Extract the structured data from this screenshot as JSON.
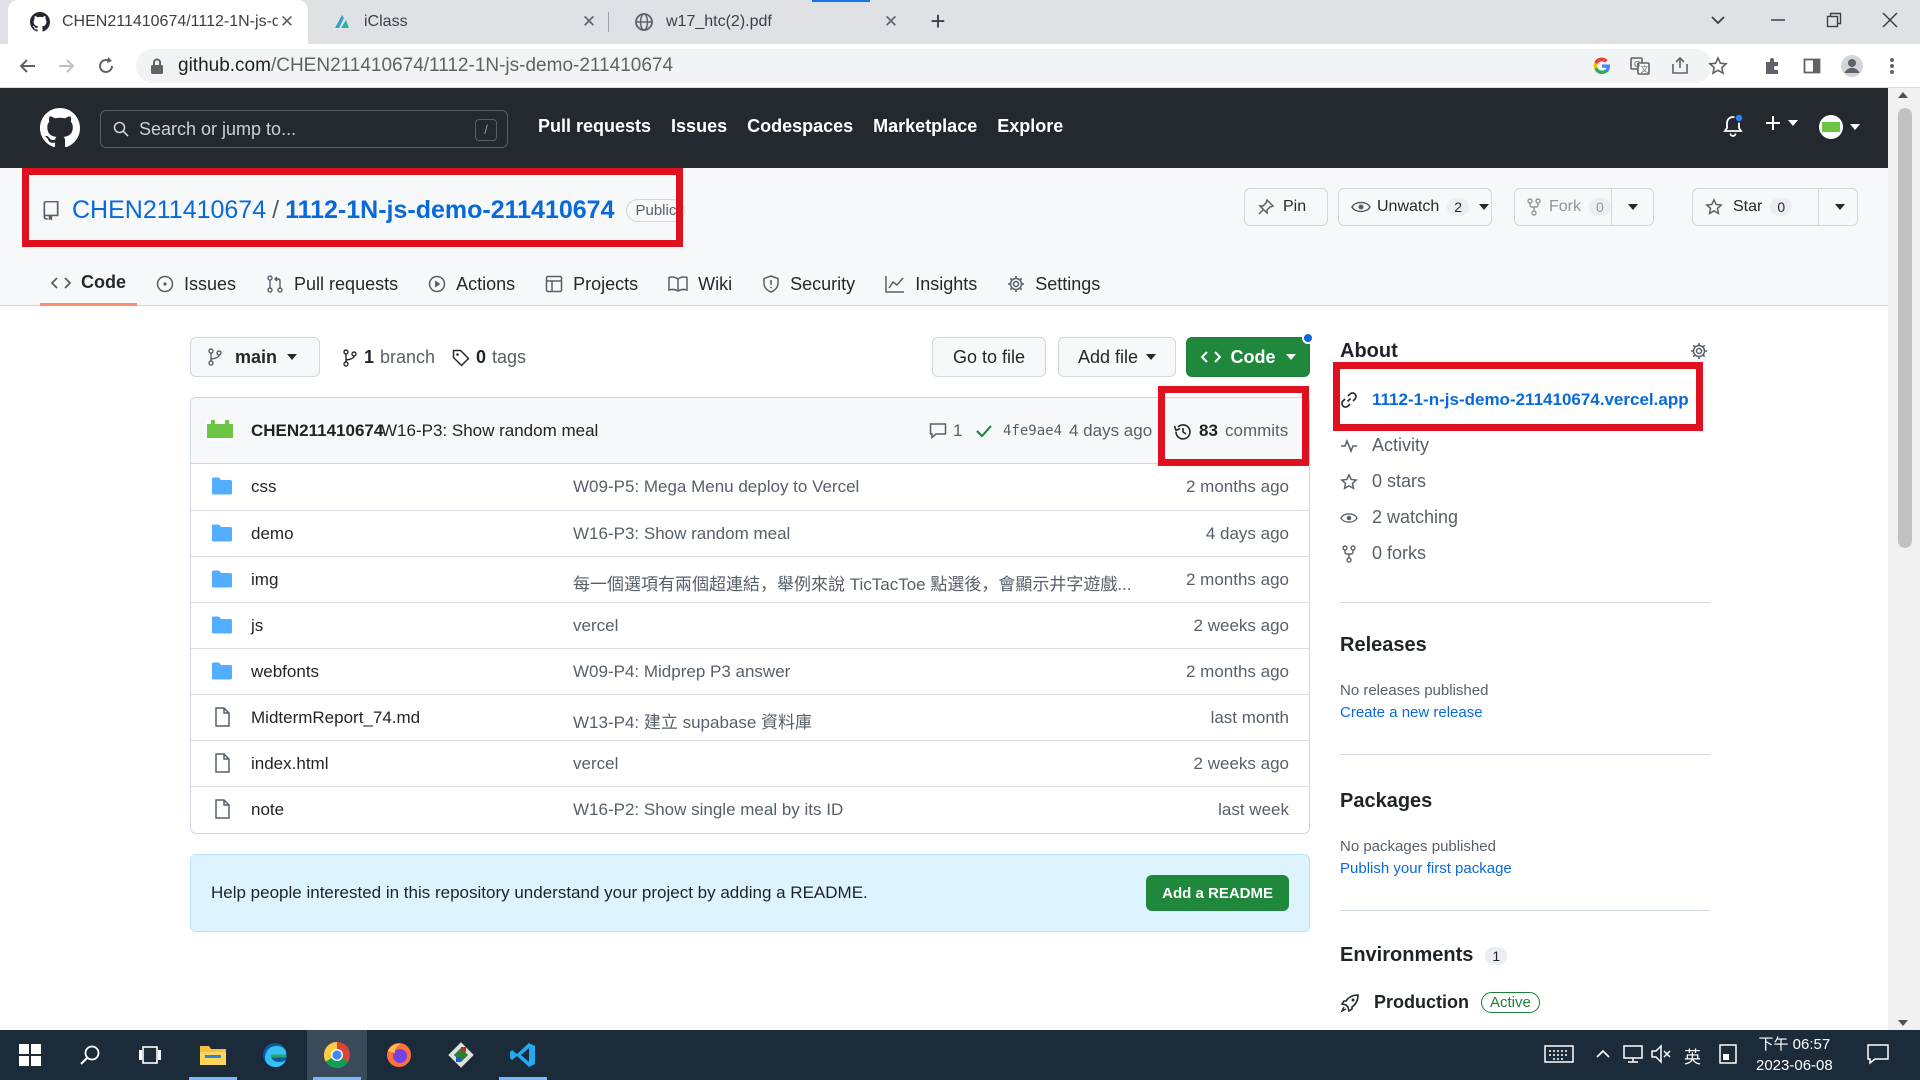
{
  "browser": {
    "tabs": [
      {
        "title": "CHEN211410674/1112-1N-js-d",
        "active": true
      },
      {
        "title": "iClass",
        "active": false
      },
      {
        "title": "w17_htc(2).pdf",
        "active": false
      }
    ],
    "url_host": "github.com",
    "url_path": "/CHEN211410674/1112-1N-js-demo-211410674"
  },
  "gh_header": {
    "search_placeholder": "Search or jump to...",
    "search_key": "/",
    "nav": [
      "Pull requests",
      "Issues",
      "Codespaces",
      "Marketplace",
      "Explore"
    ]
  },
  "repo": {
    "owner": "CHEN211410674",
    "separator": "/",
    "name": "1112-1N-js-demo-211410674",
    "visibility": "Public",
    "pin_label": "Pin",
    "watch_label": "Unwatch",
    "watch_count": "2",
    "fork_label": "Fork",
    "fork_count": "0",
    "star_label": "Star",
    "star_count": "0",
    "tabs": [
      "Code",
      "Issues",
      "Pull requests",
      "Actions",
      "Projects",
      "Wiki",
      "Security",
      "Insights",
      "Settings"
    ]
  },
  "toolbar": {
    "branch": "main",
    "branch_count": "1",
    "branch_word": "branch",
    "tag_count": "0",
    "tag_word": "tags",
    "goto_file": "Go to file",
    "add_file": "Add file",
    "code": "Code"
  },
  "latest_commit": {
    "author": "CHEN211410674",
    "message": "W16-P3: Show random meal",
    "comments": "1",
    "sha": "4fe9ae4",
    "age": "4 days ago",
    "commit_count": "83",
    "commit_word": "commits"
  },
  "files": [
    {
      "type": "dir",
      "name": "css",
      "message": "W09-P5: Mega Menu deploy to Vercel",
      "age": "2 months ago"
    },
    {
      "type": "dir",
      "name": "demo",
      "message": "W16-P3: Show random meal",
      "age": "4 days ago"
    },
    {
      "type": "dir",
      "name": "img",
      "message": "每一個選項有兩個超連結，舉例來說 TicTacToe 點選後，會顯示井字遊戲...",
      "age": "2 months ago"
    },
    {
      "type": "dir",
      "name": "js",
      "message": "vercel",
      "age": "2 weeks ago"
    },
    {
      "type": "dir",
      "name": "webfonts",
      "message": "W09-P4: Midprep P3 answer",
      "age": "2 months ago"
    },
    {
      "type": "file",
      "name": "MidtermReport_74.md",
      "message": "W13-P4: 建立 supabase 資料庫",
      "age": "last month"
    },
    {
      "type": "file",
      "name": "index.html",
      "message": "vercel",
      "age": "2 weeks ago"
    },
    {
      "type": "file",
      "name": "note",
      "message": "W16-P2: Show single meal by its ID",
      "age": "last week"
    }
  ],
  "readme_prompt": {
    "text": "Help people interested in this repository understand your project by adding a README.",
    "button": "Add a README"
  },
  "about": {
    "heading": "About",
    "link": "1112-1-n-js-demo-211410674.vercel.app",
    "activity": "Activity",
    "stars": "0 stars",
    "watching": "2 watching",
    "forks": "0 forks"
  },
  "releases": {
    "heading": "Releases",
    "none": "No releases published",
    "link": "Create a new release"
  },
  "packages": {
    "heading": "Packages",
    "none": "No packages published",
    "link": "Publish your first package"
  },
  "environments": {
    "heading": "Environments",
    "count": "1",
    "name": "Production",
    "status": "Active"
  },
  "taskbar": {
    "clock_time": "下午 06:57",
    "clock_date": "2023-06-08",
    "ime": "英"
  },
  "colors": {
    "accent": "#0969da",
    "green": "#1f883d",
    "highlight": "#e0111f",
    "header": "#24292f"
  }
}
